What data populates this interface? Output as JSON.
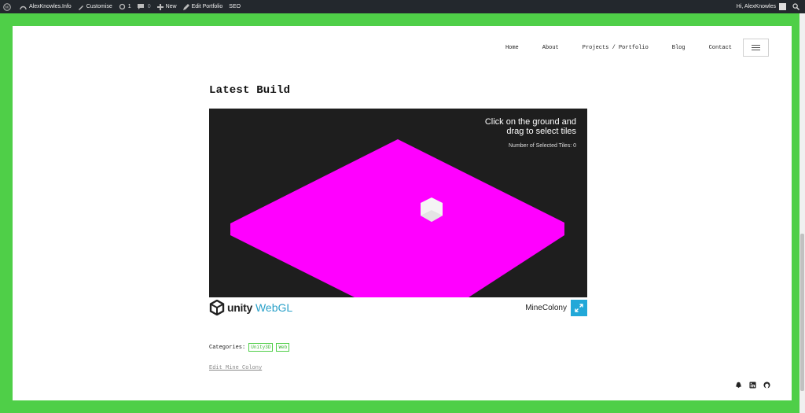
{
  "admin_bar": {
    "site_name": "AlexKnowles.Info",
    "customise": "Customise",
    "updates_count": "1",
    "comments_count": "0",
    "new_label": "New",
    "edit_label": "Edit Portfolio",
    "seo_label": "SEO",
    "greeting": "Hi, AlexKnowles"
  },
  "nav": {
    "items": [
      "Home",
      "About",
      "Projects / Portfolio",
      "Blog",
      "Contact"
    ]
  },
  "article": {
    "title": "Latest Build",
    "canvas": {
      "instruction_line1": "Click on the ground and",
      "instruction_line2": "drag to select tiles",
      "selected_label": "Number of Selected Tiles: 0",
      "ground_color": "#ff00ff",
      "background_color": "#1e1e1e"
    },
    "footer": {
      "unity_label": "unity",
      "webgl_label": "WebGL",
      "build_title": "MineColony"
    },
    "categories_label": "Categories:",
    "tags": [
      "Unity3D",
      "Web"
    ],
    "edit_link": "Edit Mine Colony"
  },
  "colors": {
    "page_background": "#4fcf48",
    "accent": "#22a8d8",
    "admin_bar": "#23282d"
  },
  "social_icons": [
    "snapchat-icon",
    "linkedin-icon",
    "github-icon"
  ]
}
